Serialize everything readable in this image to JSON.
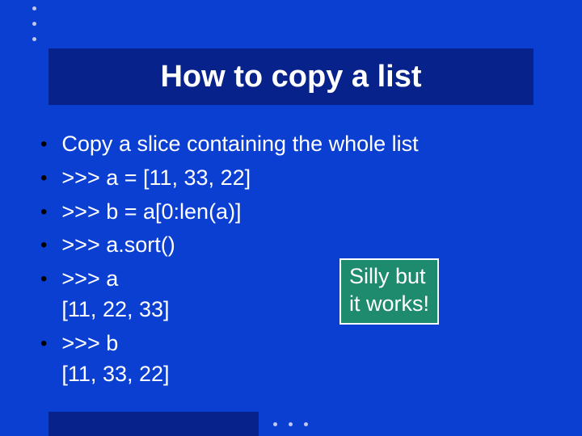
{
  "title": "How to copy a list",
  "bullets": [
    {
      "text": "Copy a slice containing the whole list"
    },
    {
      "text": ">>> a = [11, 33, 22]"
    },
    {
      "text": ">>> b = a[0:len(a)]"
    },
    {
      "text": ">>> a.sort()"
    },
    {
      "text": ">>> a\n[11, 22, 33]"
    },
    {
      "text": ">>> b\n[11, 33, 22]"
    }
  ],
  "callout": {
    "line1": "Silly but",
    "line2": "it works!"
  }
}
